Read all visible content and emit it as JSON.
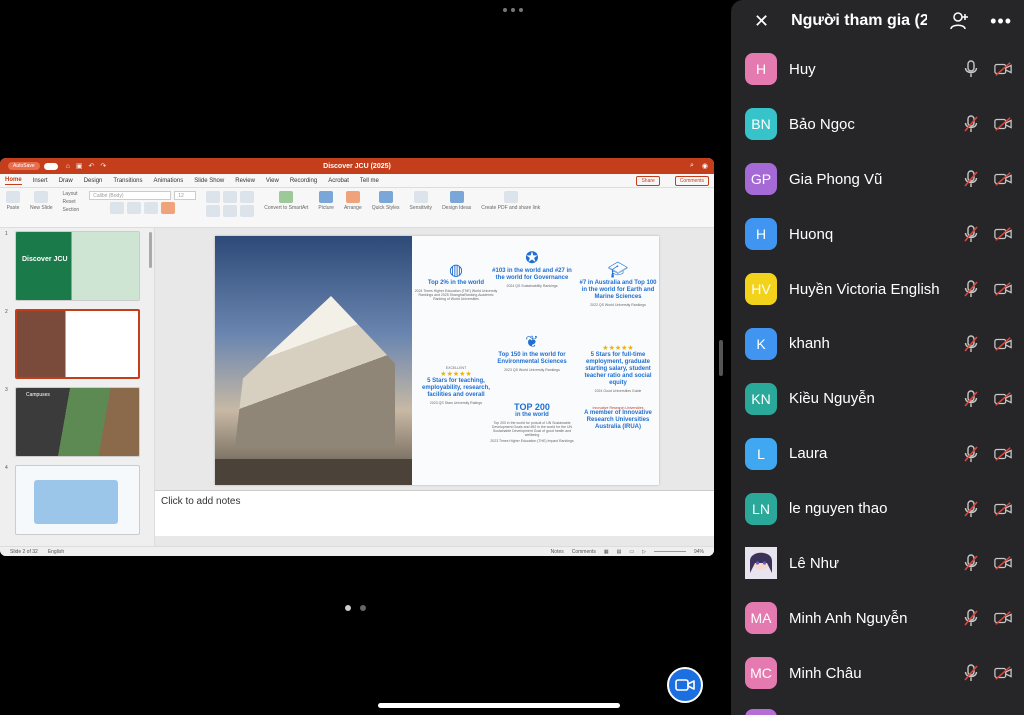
{
  "ppt": {
    "autosave_label": "AutoSave",
    "autosave_state": "OFF",
    "doc_title": "Discover JCU (2025)",
    "tabs": [
      "Home",
      "Insert",
      "Draw",
      "Design",
      "Transitions",
      "Animations",
      "Slide Show",
      "Review",
      "View",
      "Recording",
      "Acrobat",
      "Tell me"
    ],
    "share_label": "Share",
    "comments_label": "Comments",
    "ribbon": {
      "paste": "Paste",
      "new_slide": "New Slide",
      "layout": "Layout",
      "reset": "Reset",
      "section": "Section",
      "font": "Calibri (Body)",
      "size": "12",
      "convert": "Convert to SmartArt",
      "picture": "Picture",
      "arrange": "Arrange",
      "quick_styles": "Quick Styles",
      "sensitivity": "Sensitivity",
      "design_ideas": "Design Ideas",
      "create_pdf": "Create PDF and share link"
    },
    "thumbs": [
      {
        "num": "1",
        "caption": "Discover JCU"
      },
      {
        "num": "2",
        "caption": ""
      },
      {
        "num": "3",
        "caption": "Campuses"
      },
      {
        "num": "4",
        "caption": ""
      }
    ],
    "slide": {
      "cells": [
        {
          "head": "Top 2% in the world",
          "sub": "2024 Times Higher Education (THE) World University Rankings and 2025 ShanghaiRanking Academic Ranking of World Universities",
          "icon": "globe-icon"
        },
        {
          "head": "#103 in the world and #27 in the world for Governance",
          "sub": "2024 QS Sustainability Rankings",
          "icon": "medal-icon"
        },
        {
          "head": "#7 in Australia and Top 100 in the world for Earth and Marine Sciences",
          "sub": "2022 QS World University Rankings",
          "icon": "graduation-cap-icon"
        },
        {
          "head": "Top 150 in the world for Environmental Sciences",
          "sub": "2023 QS World University Rankings",
          "icon": "leaf-icon"
        },
        {
          "head": "5 Stars for full-time employment, graduate starting salary, student teacher ratio and social equity",
          "sub": "2024 Good Universities Guide",
          "icon": "stars-icon"
        },
        {
          "head": "5 Stars for teaching, employability, research, facilities and overall",
          "sub": "2023 QS Stars University Ratings",
          "icon": "qs-stars-icon",
          "badge": "EXCELLENT"
        },
        {
          "head": "TOP 200",
          "sub": "in the world",
          "detail": "Top 200 in the world for pursuit of UN Sustainable Development Goals and #52 in the world for the UN Sustainable Development Goal of good health and wellbeing",
          "source": "2023 Times Higher Education (THE) Impact Rankings",
          "icon": "top200-icon"
        },
        {
          "head": "A member of Innovative Research Universities Australia (IRUA)",
          "sub": "Innovative Research Universities",
          "icon": "iru-logo-icon"
        }
      ]
    },
    "notes_placeholder": "Click to add notes",
    "status": {
      "slide_of": "Slide 2 of 32",
      "language": "English",
      "notes": "Notes",
      "comments": "Comments",
      "zoom": "94%"
    }
  },
  "panel": {
    "title": "Người tham gia (2...",
    "participants": [
      {
        "initials": "H",
        "name": "Huy",
        "color": "#e57ab0",
        "mic_muted": false,
        "avatar_image": false
      },
      {
        "initials": "BN",
        "name": "Bảo Ngọc",
        "color": "#36c3c9",
        "mic_muted": true,
        "avatar_image": false
      },
      {
        "initials": "GP",
        "name": "Gia Phong Vũ",
        "color": "#a56ad6",
        "mic_muted": true,
        "avatar_image": false
      },
      {
        "initials": "H",
        "name": "Huonq",
        "color": "#3f95f0",
        "mic_muted": true,
        "avatar_image": false
      },
      {
        "initials": "HV",
        "name": "Huyền Victoria English",
        "color": "#f2d21a",
        "mic_muted": true,
        "avatar_image": false
      },
      {
        "initials": "K",
        "name": "khanh",
        "color": "#3f95f0",
        "mic_muted": true,
        "avatar_image": false
      },
      {
        "initials": "KN",
        "name": "Kiều Nguyễn",
        "color": "#2aa99b",
        "mic_muted": true,
        "avatar_image": false
      },
      {
        "initials": "L",
        "name": "Laura",
        "color": "#3fa8f0",
        "mic_muted": true,
        "avatar_image": false
      },
      {
        "initials": "LN",
        "name": "le nguyen thao",
        "color": "#2aa99b",
        "mic_muted": true,
        "avatar_image": false
      },
      {
        "initials": "",
        "name": "Lê Như",
        "color": "#e8e4ef",
        "mic_muted": true,
        "avatar_image": true
      },
      {
        "initials": "MA",
        "name": "Minh Anh Nguyễn",
        "color": "#e57ab0",
        "mic_muted": true,
        "avatar_image": false
      },
      {
        "initials": "MC",
        "name": "Minh Châu",
        "color": "#e57ab0",
        "mic_muted": true,
        "avatar_image": false
      }
    ]
  }
}
